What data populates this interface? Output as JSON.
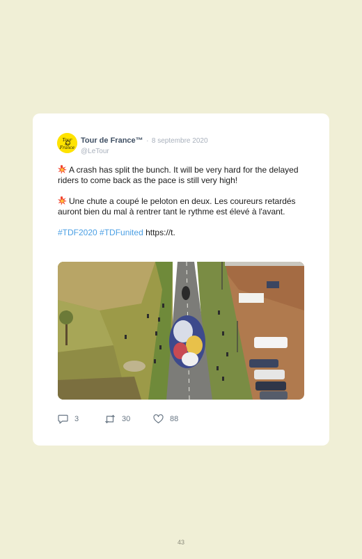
{
  "tweet": {
    "author_name": "Tour de France™",
    "separator": "·",
    "date": "8 septembre 2020",
    "handle": "@LeTour",
    "avatar_logo_text": "Tour de France",
    "paragraph_en": "A crash has split the bunch. It will be very hard for the delayed riders to come back as the pace is still very high!",
    "paragraph_fr": "Une chute a coupé le peloton en deux. Les coureurs retardés auront bien du mal à rentrer tant le rythme est élevé à l'avant.",
    "hashtag_1": "#TDF2020",
    "hashtag_2": "#TDFunited",
    "link": "https://t.",
    "emoji": "collision-icon",
    "media_description": "aerial photo of the peloton",
    "replies": "3",
    "retweets": "30",
    "likes": "88"
  },
  "page": {
    "number": "43"
  },
  "colors": {
    "page_background": "#f0efd6",
    "card": "#ffffff",
    "hashtag": "#4a9fe4",
    "avatar": "#ffe300"
  }
}
